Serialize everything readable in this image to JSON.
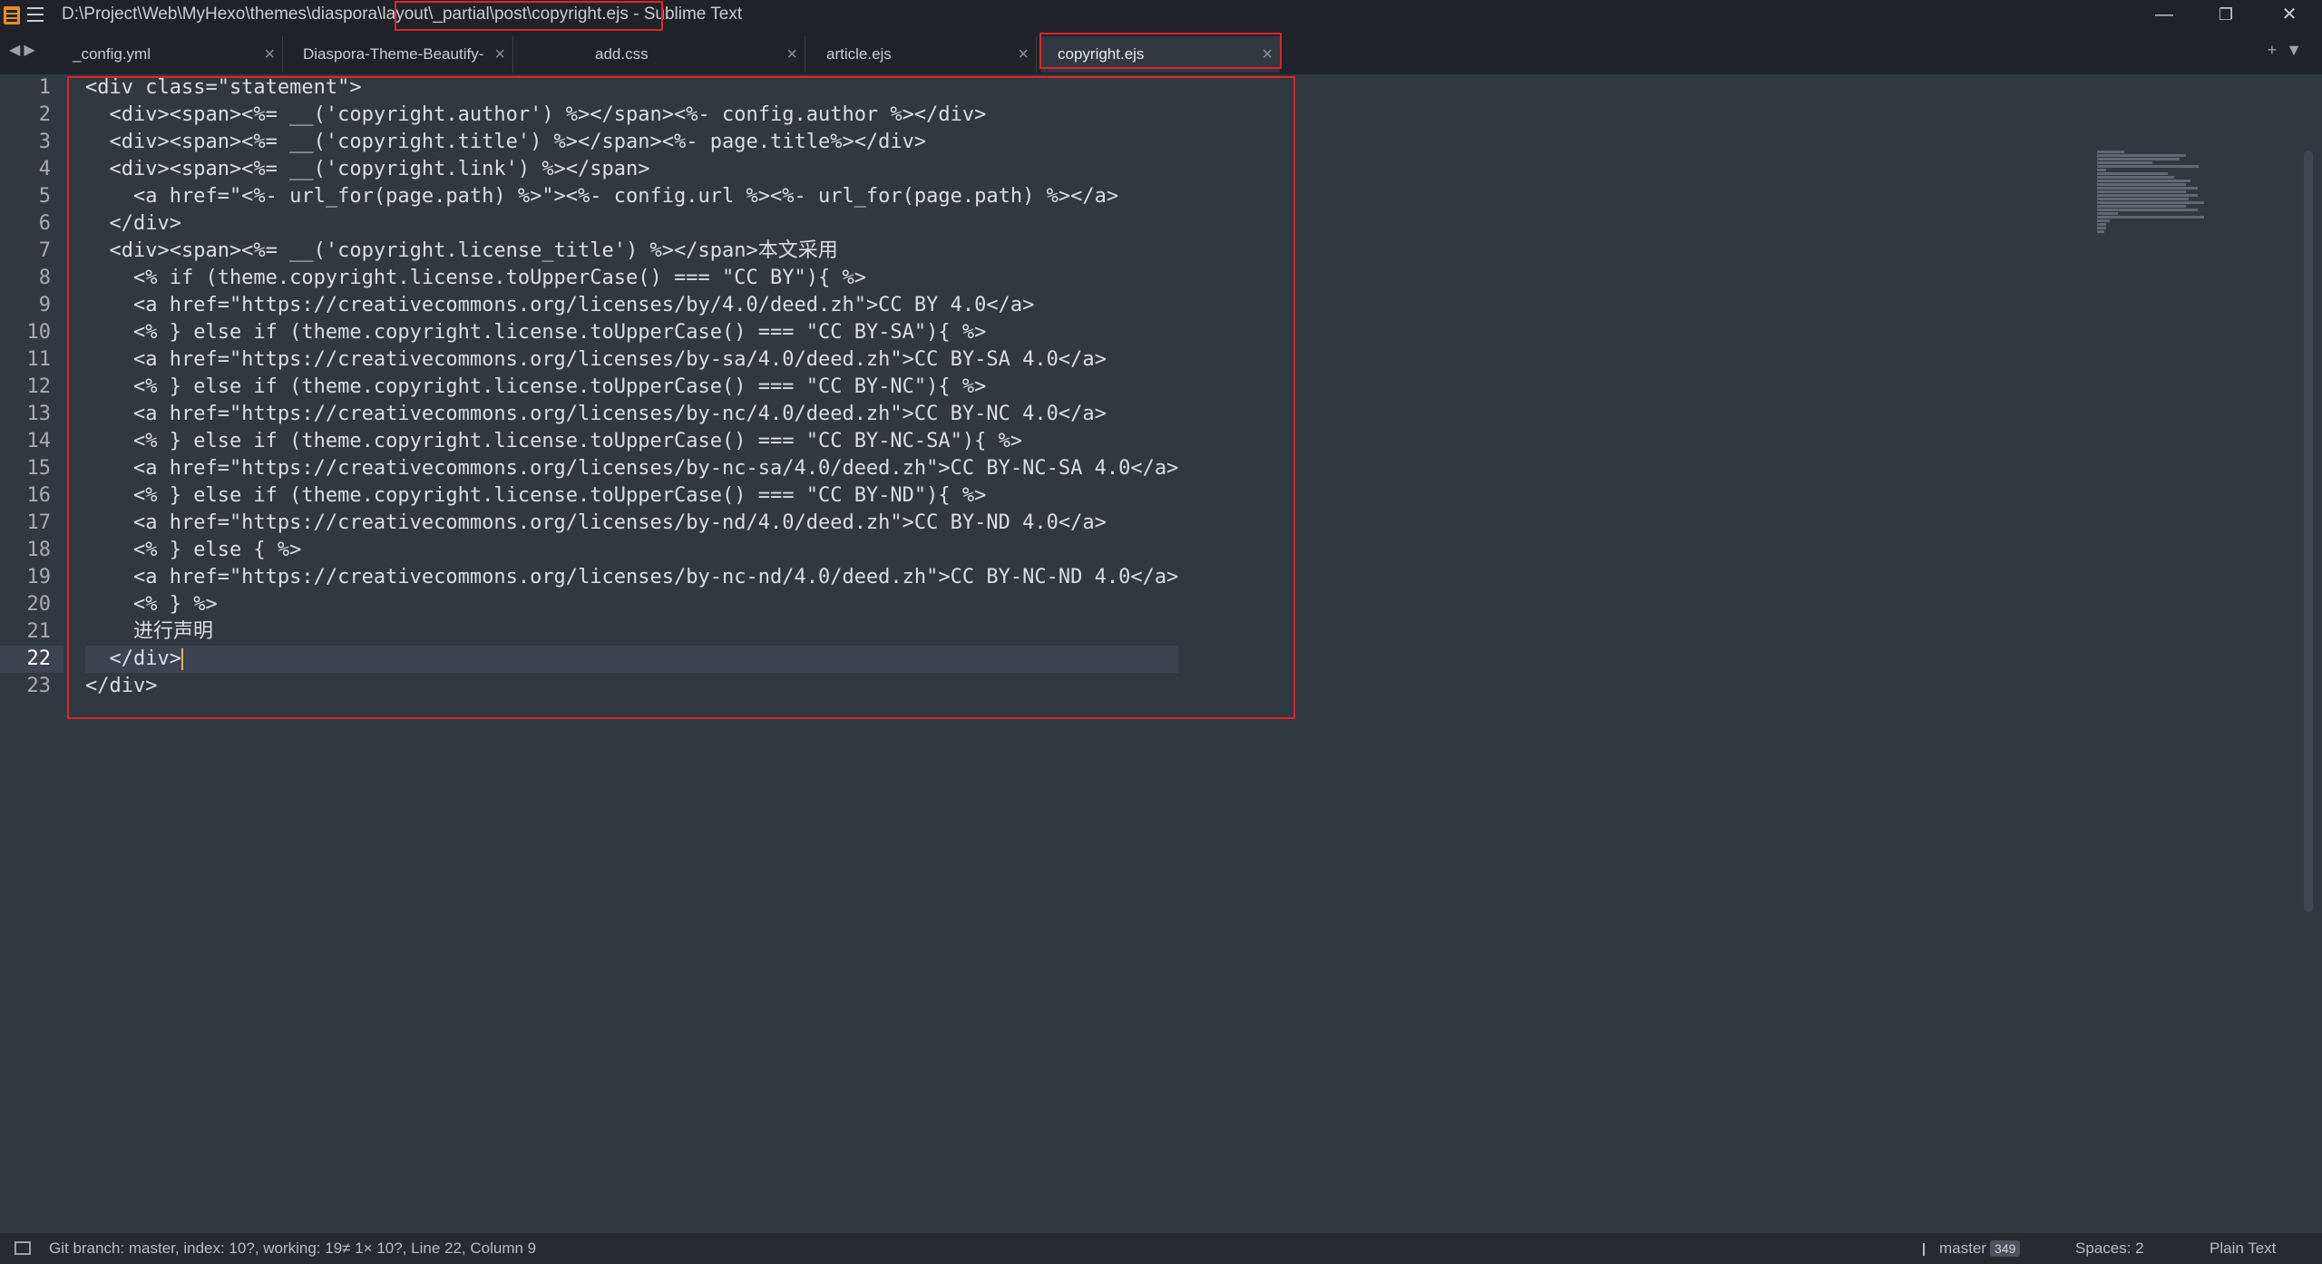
{
  "window": {
    "title": "D:\\Project\\Web\\MyHexo\\themes\\diaspora\\layout\\_partial\\post\\copyright.ejs - Sublime Text",
    "minimize": "—",
    "maximize": "❐",
    "close": "✕"
  },
  "tabs": [
    {
      "label": "_config.yml",
      "active": false
    },
    {
      "label": "Diaspora-Theme-Beautify-Diary.md",
      "active": false
    },
    {
      "label": "add.css",
      "active": false
    },
    {
      "label": "article.ejs",
      "active": false
    },
    {
      "label": "copyright.ejs",
      "active": true
    }
  ],
  "tab_close_glyph": "×",
  "nav": {
    "back": "◀",
    "forward": "▶",
    "new_tab": "+",
    "dropdown": "▼"
  },
  "editor": {
    "current_line": 22,
    "line_numbers": [
      "1",
      "2",
      "3",
      "4",
      "5",
      "6",
      "7",
      "8",
      "9",
      "10",
      "11",
      "12",
      "13",
      "14",
      "15",
      "16",
      "17",
      "18",
      "19",
      "20",
      "21",
      "22",
      "23"
    ],
    "lines": [
      "<div class=\"statement\">",
      "  <div><span><%= __('copyright.author') %></span><%- config.author %></div>",
      "  <div><span><%= __('copyright.title') %></span><%- page.title%></div>",
      "  <div><span><%= __('copyright.link') %></span>",
      "    <a href=\"<%- url_for(page.path) %>\"><%- config.url %><%- url_for(page.path) %></a>",
      "  </div>",
      "  <div><span><%= __('copyright.license_title') %></span>本文采用",
      "    <% if (theme.copyright.license.toUpperCase() === \"CC BY\"){ %>",
      "    <a href=\"https://creativecommons.org/licenses/by/4.0/deed.zh\">CC BY 4.0</a>",
      "    <% } else if (theme.copyright.license.toUpperCase() === \"CC BY-SA\"){ %>",
      "    <a href=\"https://creativecommons.org/licenses/by-sa/4.0/deed.zh\">CC BY-SA 4.0</a>",
      "    <% } else if (theme.copyright.license.toUpperCase() === \"CC BY-NC\"){ %>",
      "    <a href=\"https://creativecommons.org/licenses/by-nc/4.0/deed.zh\">CC BY-NC 4.0</a>",
      "    <% } else if (theme.copyright.license.toUpperCase() === \"CC BY-NC-SA\"){ %>",
      "    <a href=\"https://creativecommons.org/licenses/by-nc-sa/4.0/deed.zh\">CC BY-NC-SA 4.0</a>",
      "    <% } else if (theme.copyright.license.toUpperCase() === \"CC BY-ND\"){ %>",
      "    <a href=\"https://creativecommons.org/licenses/by-nd/4.0/deed.zh\">CC BY-ND 4.0</a>",
      "    <% } else { %>",
      "    <a href=\"https://creativecommons.org/licenses/by-nc-nd/4.0/deed.zh\">CC BY-NC-ND 4.0</a>",
      "    <% } %>",
      "    进行声明",
      "  </div>",
      "</div>"
    ]
  },
  "status": {
    "left": "Git branch: master, index: 10?, working: 19≠ 1× 10?, Line 22, Column 9",
    "branch": "master",
    "branch_count": "349",
    "spaces": "Spaces: 2",
    "syntax": "Plain Text"
  },
  "colors": {
    "highlight": "#e0242a",
    "background": "#303841",
    "cursor": "#f9ae58"
  }
}
